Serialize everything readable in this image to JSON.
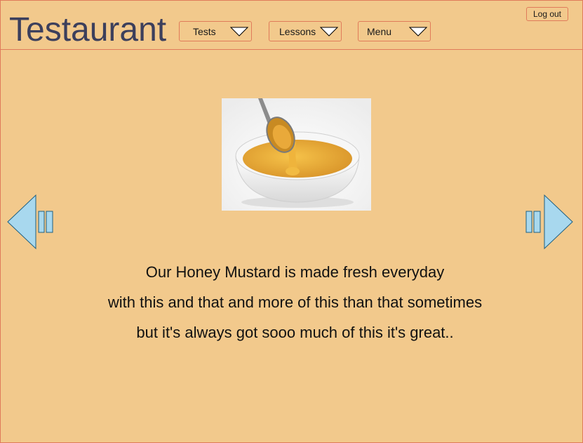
{
  "header": {
    "logo": "Testaurant",
    "menus": [
      {
        "label": "Tests"
      },
      {
        "label": "Lessons"
      },
      {
        "label": "Menu"
      }
    ],
    "logout_label": "Log out"
  },
  "content": {
    "image_subject": "honey mustard sauce in bowl with spoon",
    "description_lines": [
      "Our Honey Mustard is made fresh everyday",
      "with this and that and more of this than that sometimes",
      "but it's always got sooo much of this it's great.."
    ]
  },
  "icons": {
    "prev": "previous-arrow-icon",
    "next": "next-arrow-icon",
    "dropdown": "triangle-down-icon"
  },
  "colors": {
    "background": "#f2c98c",
    "border": "#e07b5a",
    "logo_text": "#3c3f5c",
    "arrow_fill": "#a8d8ee"
  }
}
